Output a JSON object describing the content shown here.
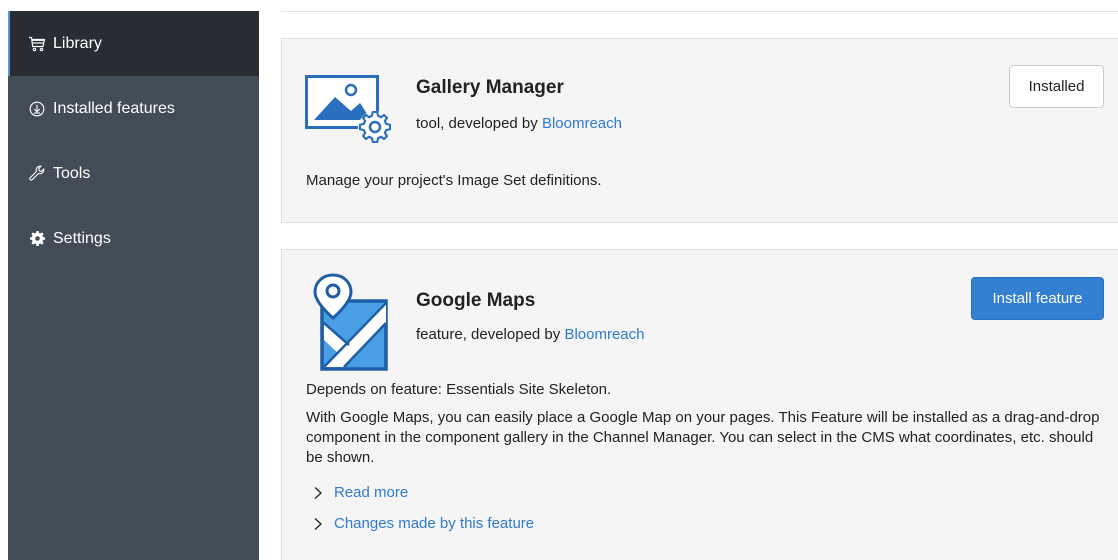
{
  "sidebar": {
    "items": [
      {
        "label": "Library",
        "icon": "cart-icon",
        "active": true
      },
      {
        "label": "Installed features",
        "icon": "download-circle-icon",
        "active": false
      },
      {
        "label": "Tools",
        "icon": "wrench-icon",
        "active": false
      },
      {
        "label": "Settings",
        "icon": "gear-icon",
        "active": false
      }
    ]
  },
  "features": [
    {
      "title": "Gallery Manager",
      "type_prefix": "tool, developed by ",
      "developer": "Bloomreach",
      "button_label": "Installed",
      "description": "Manage your project's Image Set definitions.",
      "icon": "gallery-image-gear-icon"
    },
    {
      "title": "Google Maps",
      "type_prefix": "feature, developed by ",
      "developer": "Bloomreach",
      "button_label": "Install feature",
      "depends": "Depends on feature: Essentials Site Skeleton.",
      "description": "With Google Maps, you can easily place a Google Map on your pages. This Feature will be installed as a drag-and-drop component in the component gallery in the Channel Manager. You can select in the CMS what coordinates, etc. should be shown.",
      "read_more": "Read more",
      "changes": "Changes made by this feature",
      "icon": "map-pin-icon"
    }
  ],
  "colors": {
    "sidebar_bg": "#424c57",
    "sidebar_active_bg": "#272d33",
    "accent": "#337fd2",
    "link": "#2f7ad0",
    "icon_blue": "#2a6fbd"
  }
}
